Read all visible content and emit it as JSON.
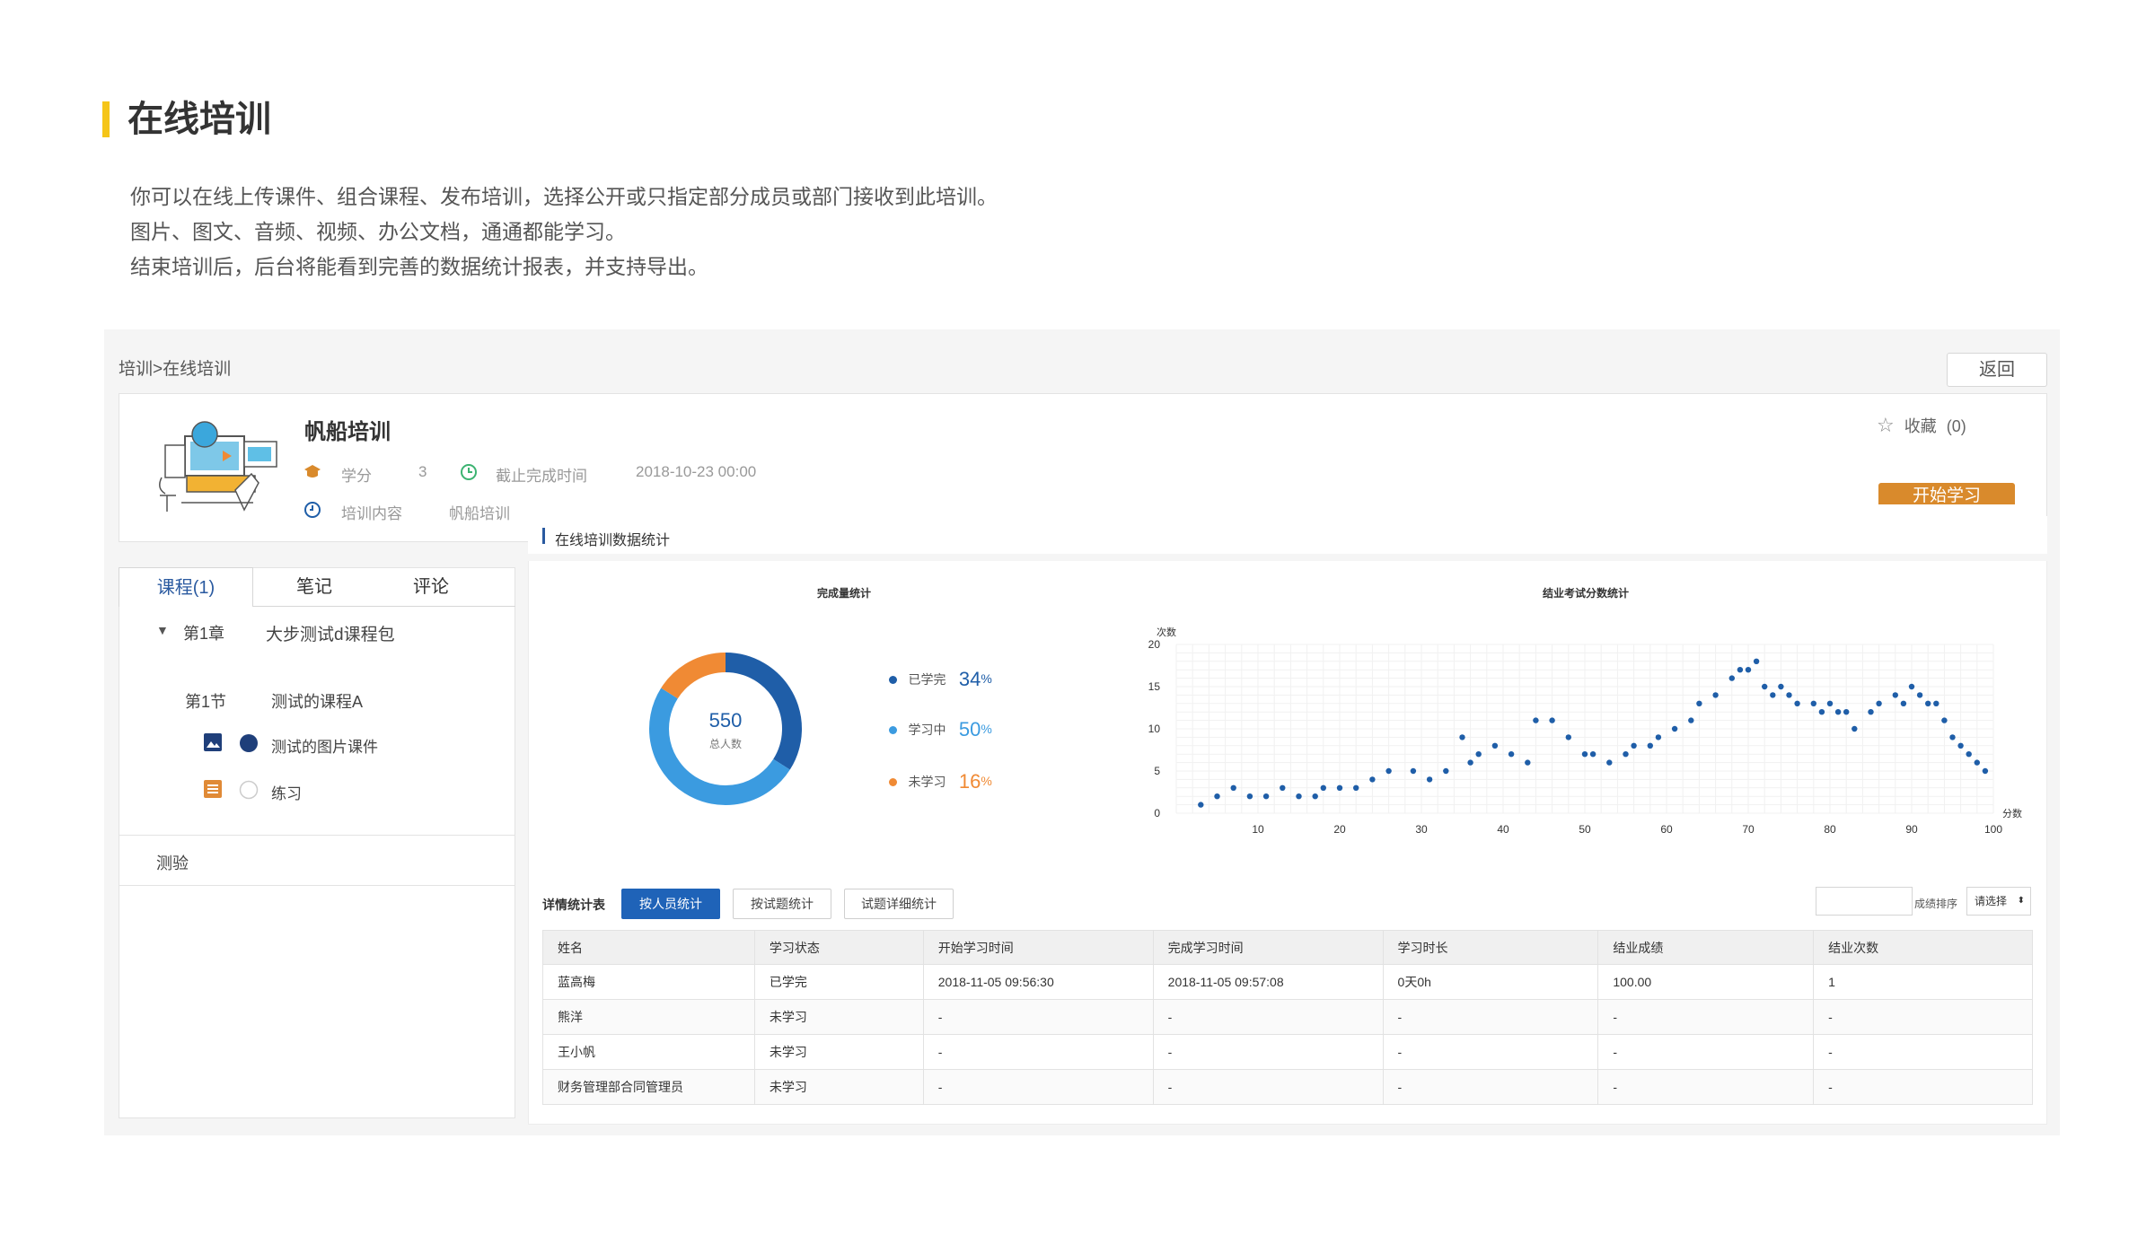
{
  "page": {
    "title": "在线培训",
    "intro": [
      "你可以在线上传课件、组合课程、发布培训，选择公开或只指定部分成员或部门接收到此培训。",
      "图片、图文、音频、视频、办公文档，通通都能学习。",
      "结束培训后，后台将能看到完善的数据统计报表，并支持导出。"
    ]
  },
  "header": {
    "breadcrumb": "培训>在线培训",
    "back_label": "返回"
  },
  "course": {
    "name": "帆船培训",
    "credit_label": "学分",
    "credit_value": "3",
    "deadline_label": "截止完成时间",
    "deadline_value": "2018-10-23 00:00",
    "content_label": "培训内容",
    "content_value": "帆船培训",
    "favorite_label": "收藏",
    "favorite_count": "(0)",
    "start_label": "开始学习"
  },
  "tabs": [
    {
      "label": "课程(1)"
    },
    {
      "label": "笔记"
    },
    {
      "label": "评论"
    }
  ],
  "tree": {
    "chapter_label": "第1章",
    "chapter_name": "大步测试d课程包",
    "section_label": "第1节",
    "section_name": "测试的课程A",
    "items": [
      {
        "label": "测试的图片课件"
      },
      {
        "label": "练习"
      }
    ],
    "quiz_label": "测验"
  },
  "stats": {
    "title": "在线培训数据统计",
    "donut_title": "完成量统计",
    "total_value": "550",
    "total_label": "总人数",
    "legend": [
      {
        "label": "已学完",
        "value": "34",
        "unit": "%",
        "color": "#1f5ea8"
      },
      {
        "label": "学习中",
        "value": "50",
        "unit": "%",
        "color": "#3b9be0"
      },
      {
        "label": "未学习",
        "value": "16",
        "unit": "%",
        "color": "#f08a34"
      }
    ],
    "scatter_title": "结业考试分数统计",
    "detail_label": "详情统计表",
    "subtabs": [
      {
        "label": "按人员统计"
      },
      {
        "label": "按试题统计"
      },
      {
        "label": "试题详细统计"
      }
    ],
    "sort_label": "成绩排序",
    "sort_select": "请选择"
  },
  "table": {
    "headers": [
      "姓名",
      "学习状态",
      "开始学习时间",
      "完成学习时间",
      "学习时长",
      "结业成绩",
      "结业次数"
    ],
    "rows": [
      [
        "蓝高梅",
        "已学完",
        "2018-11-05 09:56:30",
        "2018-11-05 09:57:08",
        "0天0h",
        "100.00",
        "1"
      ],
      [
        "熊洋",
        "未学习",
        "-",
        "-",
        "-",
        "-",
        "-"
      ],
      [
        "王小帆",
        "未学习",
        "-",
        "-",
        "-",
        "-",
        "-"
      ],
      [
        "财务管理部合同管理员",
        "未学习",
        "-",
        "-",
        "-",
        "-",
        "-"
      ]
    ]
  },
  "chart_data": [
    {
      "type": "pie",
      "title": "完成量统计",
      "categories": [
        "已学完",
        "学习中",
        "未学习"
      ],
      "values": [
        34,
        50,
        16
      ],
      "colors": [
        "#1f5ea8",
        "#3b9be0",
        "#f08a34"
      ]
    },
    {
      "type": "scatter",
      "title": "结业考试分数统计",
      "xlabel": "分数",
      "ylabel": "次数",
      "xlim": [
        0,
        100
      ],
      "ylim": [
        0,
        20
      ],
      "xticks": [
        10,
        20,
        30,
        40,
        50,
        60,
        70,
        80,
        90,
        100
      ],
      "yticks": [
        0,
        5,
        10,
        15,
        20
      ],
      "grid": true,
      "color": "#1f5ea8",
      "x": [
        3,
        5,
        7,
        9,
        11,
        13,
        15,
        17,
        18,
        20,
        22,
        24,
        26,
        29,
        31,
        33,
        35,
        36,
        37,
        39,
        41,
        43,
        44,
        46,
        48,
        50,
        51,
        53,
        55,
        56,
        58,
        59,
        61,
        63,
        64,
        66,
        68,
        69,
        70,
        71,
        72,
        73,
        74,
        75,
        76,
        78,
        79,
        80,
        81,
        82,
        83,
        85,
        86,
        88,
        89,
        90,
        91,
        92,
        93,
        94,
        95,
        96,
        97,
        98,
        99
      ],
      "y": [
        1,
        2,
        3,
        2,
        2,
        3,
        2,
        2,
        3,
        3,
        3,
        4,
        5,
        5,
        4,
        5,
        9,
        6,
        7,
        8,
        7,
        6,
        11,
        11,
        9,
        7,
        7,
        6,
        7,
        8,
        8,
        9,
        10,
        11,
        13,
        14,
        16,
        17,
        17,
        18,
        15,
        14,
        15,
        14,
        13,
        13,
        12,
        13,
        12,
        12,
        10,
        12,
        13,
        14,
        13,
        15,
        14,
        13,
        13,
        11,
        9,
        8,
        7,
        6,
        5
      ]
    }
  ]
}
